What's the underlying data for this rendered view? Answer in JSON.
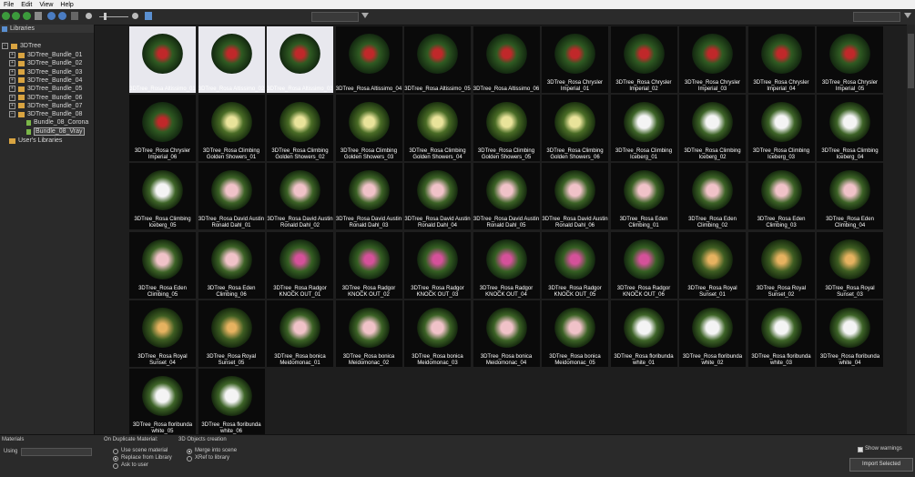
{
  "menu": [
    "File",
    "Edit",
    "View",
    "Help"
  ],
  "sidebar": {
    "header": "Libraries",
    "root": "3DTree",
    "bundles": [
      "3DTree_Bundle_01",
      "3DTree_Bundle_02",
      "3DTree_Bundle_03",
      "3DTree_Bundle_04",
      "3DTree_Bundle_05",
      "3DTree_Bundle_06",
      "3DTree_Bundle_07",
      "3DTree_Bundle_08"
    ],
    "children": [
      "Bundle_08_Corona",
      "Bundle_08_Vray"
    ],
    "user_libraries": "User's Libraries"
  },
  "tiles": [
    "3DTree_Rosa Altissimo_01",
    "3DTree_Rosa Altissimo_02",
    "3DTree_Rosa Altissimo_03",
    "3DTree_Rosa Altissimo_04",
    "3DTree_Rosa Altissimo_05",
    "3DTree_Rosa Altissimo_06",
    "3DTree_Rosa Chrysler Imperial_01",
    "3DTree_Rosa Chrysler Imperial_02",
    "3DTree_Rosa Chrysler Imperial_03",
    "3DTree_Rosa Chrysler Imperial_04",
    "3DTree_Rosa Chrysler Imperial_05",
    "3DTree_Rosa Chrysler Imperial_06",
    "3DTree_Rosa Climbing Golden Showers_01",
    "3DTree_Rosa Climbing Golden Showers_02",
    "3DTree_Rosa Climbing Golden Showers_03",
    "3DTree_Rosa Climbing Golden Showers_04",
    "3DTree_Rosa Climbing Golden Showers_05",
    "3DTree_Rosa Climbing Golden Showers_06",
    "3DTree_Rosa Climbing Iceberg_01",
    "3DTree_Rosa Climbing Iceberg_02",
    "3DTree_Rosa Climbing Iceberg_03",
    "3DTree_Rosa Climbing Iceberg_04",
    "3DTree_Rosa Climbing Iceberg_05",
    "3DTree_Rosa David Austin Ronald Dahl_01",
    "3DTree_Rosa David Austin Ronald Dahl_02",
    "3DTree_Rosa David Austin Ronald Dahl_03",
    "3DTree_Rosa David Austin Ronald Dahl_04",
    "3DTree_Rosa David Austin Ronald Dahl_05",
    "3DTree_Rosa David Austin Ronald Dahl_06",
    "3DTree_Rosa Eden Climbing_01",
    "3DTree_Rosa Eden Climbing_02",
    "3DTree_Rosa Eden Climbing_03",
    "3DTree_Rosa Eden Climbing_04",
    "3DTree_Rosa Eden Climbing_05",
    "3DTree_Rosa Eden Climbing_06",
    "3DTree_Rosa Radgor KNOCK OUT_01",
    "3DTree_Rosa Radgor KNOCK OUT_02",
    "3DTree_Rosa Radgor KNOCK OUT_03",
    "3DTree_Rosa Radgor KNOCK OUT_04",
    "3DTree_Rosa Radgor KNOCK OUT_05",
    "3DTree_Rosa Radgor KNOCK OUT_06",
    "3DTree_Rosa Royal Sunset_01",
    "3DTree_Rosa Royal Sunset_02",
    "3DTree_Rosa Royal Sunset_03",
    "3DTree_Rosa Royal Sunset_04",
    "3DTree_Rosa Royal Sunset_05",
    "3DTree_Rosa bonica Meidomonac_01",
    "3DTree_Rosa bonica Meidomonac_02",
    "3DTree_Rosa bonica Meidomonac_03",
    "3DTree_Rosa bonica Meidomonac_04",
    "3DTree_Rosa bonica Meidomonac_05",
    "3DTree_Rosa floribunda white_01",
    "3DTree_Rosa floribunda white_02",
    "3DTree_Rosa floribunda white_03",
    "3DTree_Rosa floribunda white_04",
    "3DTree_Rosa floribunda white_05",
    "3DTree_Rosa floribunda white_06"
  ],
  "bottom": {
    "materials_label": "Materials",
    "using_label": "Using",
    "duplicate_label": "On Duplicate Material:",
    "duplicate_options": [
      "Use scene material",
      "Replace from Library",
      "Ask to user"
    ],
    "creation_label": "3D Objects creation",
    "creation_options": [
      "Merge into scene",
      "XRef to library"
    ],
    "show_warnings": "Show warnings",
    "import_button": "Import Selected"
  }
}
